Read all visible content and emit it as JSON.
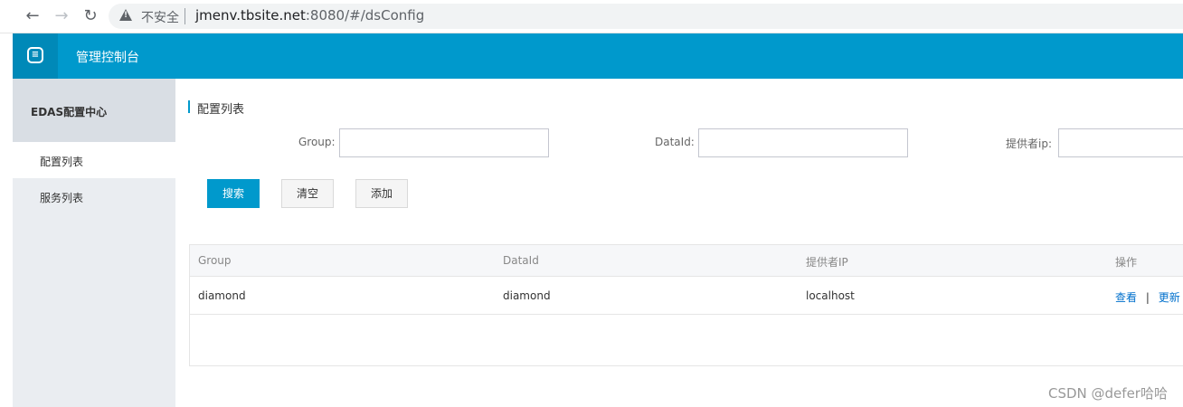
{
  "browser": {
    "back_icon": "arrow-left-icon",
    "forward_icon": "arrow-right-icon",
    "reload_icon": "reload-icon",
    "insecure_label": "不安全",
    "url_host": "jmenv.tbsite.net",
    "url_rest": ":8080/#/dsConfig"
  },
  "header": {
    "logo_icon": "cloud-logo-icon",
    "title": "管理控制台",
    "color": "#0099cc"
  },
  "sidebar": {
    "title": "EDAS配置中心",
    "items": [
      {
        "label": "配置列表",
        "active": true
      },
      {
        "label": "服务列表",
        "active": false
      }
    ]
  },
  "main": {
    "title": "配置列表",
    "filters": {
      "group_label": "Group:",
      "group_value": "",
      "dataid_label": "DataId:",
      "dataid_value": "",
      "provider_label": "提供者ip:",
      "provider_value": ""
    },
    "buttons": {
      "search": "搜索",
      "clear": "清空",
      "add": "添加"
    },
    "table": {
      "columns": [
        "Group",
        "DataId",
        "提供者IP",
        "操作"
      ],
      "rows": [
        {
          "group": "diamond",
          "dataid": "diamond",
          "ip": "localhost",
          "view": "查看",
          "sep": "|",
          "update": "更新"
        }
      ]
    }
  },
  "watermark": "CSDN @defer哈哈"
}
